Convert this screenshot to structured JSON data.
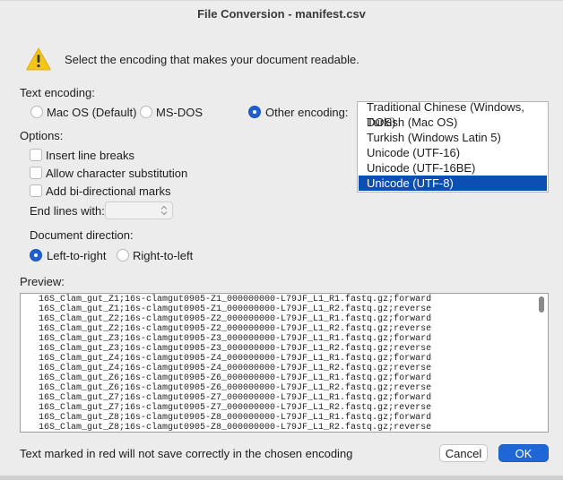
{
  "window": {
    "title": "File Conversion - manifest.csv"
  },
  "message": "Select the encoding that makes your document readable.",
  "text_encoding": {
    "label": "Text encoding:",
    "options": [
      {
        "label": "Mac OS (Default)",
        "selected": false
      },
      {
        "label": "MS-DOS",
        "selected": false
      },
      {
        "label": "Other encoding:",
        "selected": true
      }
    ],
    "list": [
      "Traditional Chinese (Windows, DOS)",
      "Turkish (Mac OS)",
      "Turkish (Windows Latin 5)",
      "Unicode (UTF-16)",
      "Unicode (UTF-16BE)",
      "Unicode (UTF-8)"
    ],
    "list_selected": "Unicode (UTF-8)"
  },
  "options": {
    "label": "Options:",
    "insert_line_breaks": "Insert line breaks",
    "allow_char_substitution": "Allow character substitution",
    "add_bidi_marks": "Add bi-directional marks",
    "end_lines_with": "End lines with:"
  },
  "direction": {
    "label": "Document direction:",
    "ltr": "Left-to-right",
    "rtl": "Right-to-left",
    "selected": "Left-to-right"
  },
  "preview": {
    "label": "Preview:",
    "lines": [
      "16S_Clam_gut_Z1;16s-clamgut0905-Z1_000000000-L79JF_L1_R1.fastq.gz;forward",
      "16S_Clam_gut_Z1;16s-clamgut0905-Z1_000000000-L79JF_L1_R2.fastq.gz;reverse",
      "16S_Clam_gut_Z2;16s-clamgut0905-Z2_000000000-L79JF_L1_R1.fastq.gz;forward",
      "16S_Clam_gut_Z2;16s-clamgut0905-Z2_000000000-L79JF_L1_R2.fastq.gz;reverse",
      "16S_Clam_gut_Z3;16s-clamgut0905-Z3_000000000-L79JF_L1_R1.fastq.gz;forward",
      "16S_Clam_gut_Z3;16s-clamgut0905-Z3_000000000-L79JF_L1_R2.fastq.gz;reverse",
      "16S_Clam_gut_Z4;16s-clamgut0905-Z4_000000000-L79JF_L1_R1.fastq.gz;forward",
      "16S_Clam_gut_Z4;16s-clamgut0905-Z4_000000000-L79JF_L1_R2.fastq.gz;reverse",
      "16S_Clam_gut_Z6;16s-clamgut0905-Z6_000000000-L79JF_L1_R1.fastq.gz;forward",
      "16S_Clam_gut_Z6;16s-clamgut0905-Z6_000000000-L79JF_L1_R2.fastq.gz;reverse",
      "16S_Clam_gut_Z7;16s-clamgut0905-Z7_000000000-L79JF_L1_R1.fastq.gz;forward",
      "16S_Clam_gut_Z7;16s-clamgut0905-Z7_000000000-L79JF_L1_R2.fastq.gz;reverse",
      "16S_Clam_gut_Z8;16s-clamgut0905-Z8_000000000-L79JF_L1_R1.fastq.gz;forward",
      "16S_Clam_gut_Z8;16s-clamgut0905-Z8_000000000-L79JF_L1_R2.fastq.gz;reverse"
    ]
  },
  "footer": {
    "note": "Text marked in red will not save correctly in the chosen encoding",
    "cancel": "Cancel",
    "ok": "OK"
  },
  "icons": {
    "warning": "warning-icon",
    "stepper": "chevron-up-down-icon"
  },
  "colors": {
    "accent": "#1f66d6",
    "selection": "#0b4fb3",
    "warning": "#f5c518"
  }
}
